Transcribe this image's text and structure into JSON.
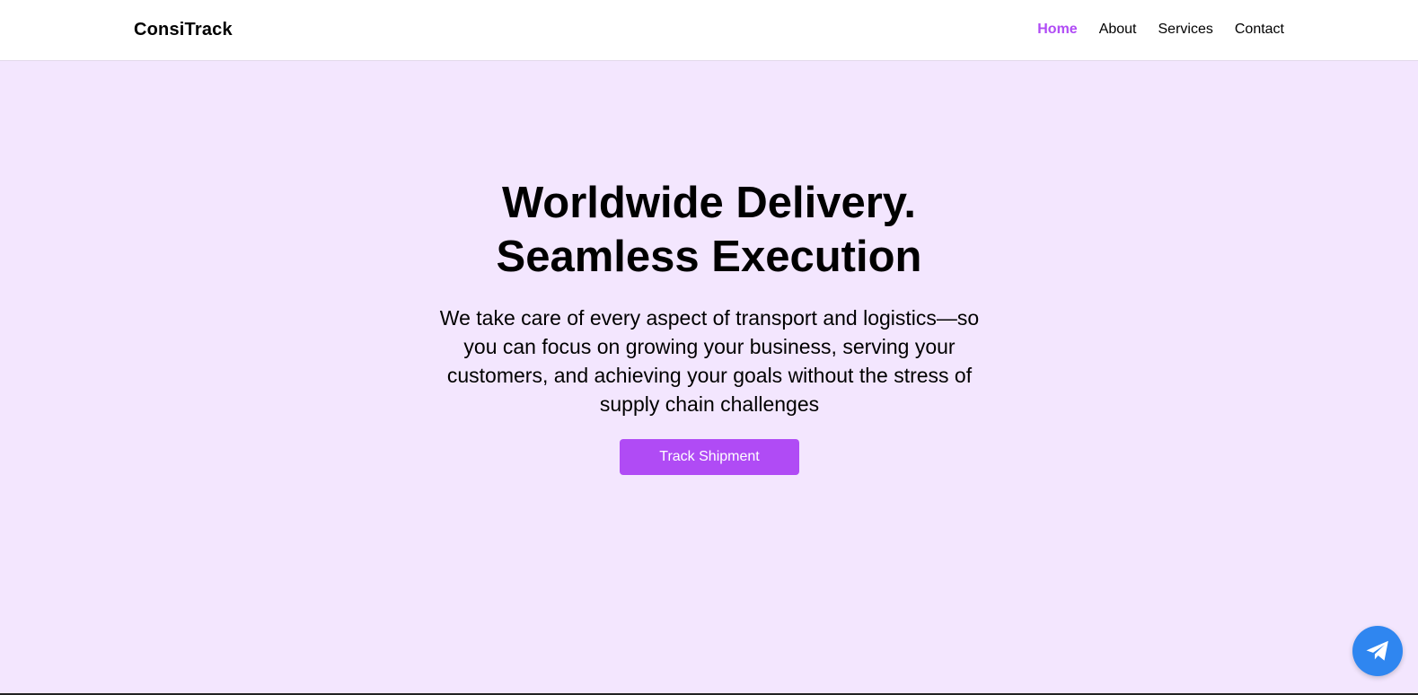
{
  "brand": {
    "name": "ConsiTrack"
  },
  "nav": {
    "items": [
      {
        "label": "Home",
        "active": true
      },
      {
        "label": "About",
        "active": false
      },
      {
        "label": "Services",
        "active": false
      },
      {
        "label": "Contact",
        "active": false
      }
    ]
  },
  "hero": {
    "title_line1": "Worldwide Delivery.",
    "title_line2": "Seamless Execution",
    "subtitle": "We take care of every aspect of transport and logistics—so you can focus on growing your business, serving your customers, and achieving your goals without the stress of supply chain challenges",
    "cta_label": "Track Shipment"
  },
  "fab": {
    "icon": "paper-plane-icon"
  },
  "colors": {
    "accent": "#b04bf5",
    "hero_background": "#f3e6fe",
    "fab": "#2f86f0"
  }
}
